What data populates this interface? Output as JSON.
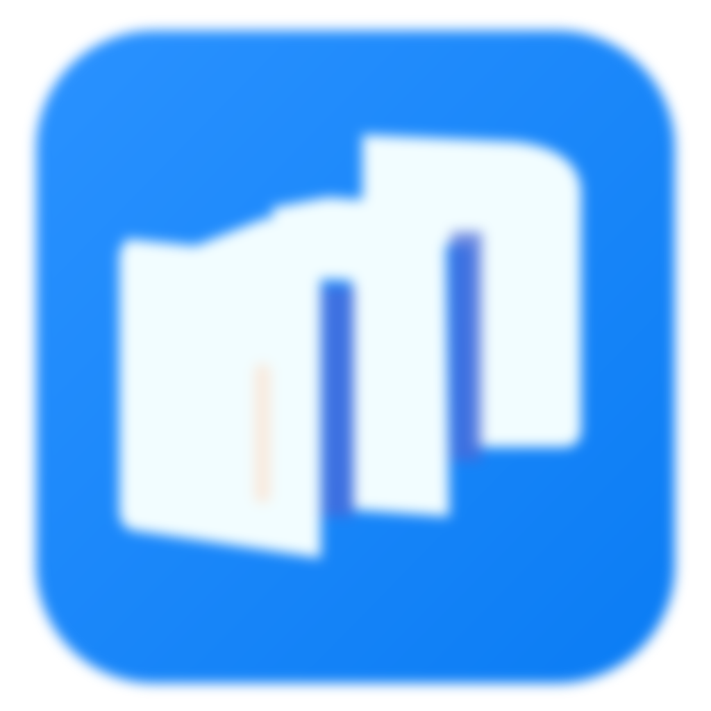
{
  "app_icon": {
    "icon": "document-stack-icon",
    "colors": {
      "background": "#0a7cf4",
      "background_light": "#2a92ff",
      "page": "#f2fdff",
      "page_shadow": "#4a6ad8"
    }
  }
}
